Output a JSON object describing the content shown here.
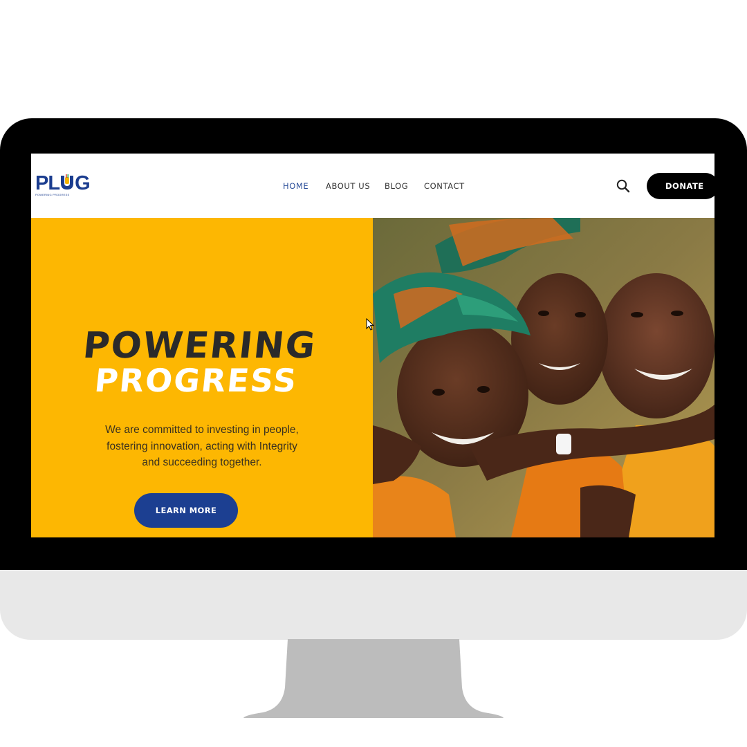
{
  "brand": {
    "logo_text_before": "PL",
    "logo_text_after": "G",
    "tagline": "POWERING PROGRESS"
  },
  "nav": {
    "items": [
      {
        "label": "HOME",
        "active": true
      },
      {
        "label": "ABOUT US",
        "active": false
      },
      {
        "label": "BLOG",
        "active": false
      },
      {
        "label": "CONTACT",
        "active": false
      }
    ]
  },
  "header": {
    "search_icon": "search-icon",
    "donate_label": "DONATE"
  },
  "hero": {
    "title_line1": "POWERING",
    "title_line2": "PROGRESS",
    "copy_line1": "We are committed to investing in people,",
    "copy_line2": "fostering innovation, acting with Integrity",
    "copy_line3": "and succeeding together.",
    "button_label": "LEARN MORE",
    "image": "three smiling children hugging"
  },
  "colors": {
    "hero_yellow": "#fdb702",
    "brand_blue": "#1c3f91",
    "nav_active": "#2c4f9a",
    "donate_bg": "#000000"
  }
}
